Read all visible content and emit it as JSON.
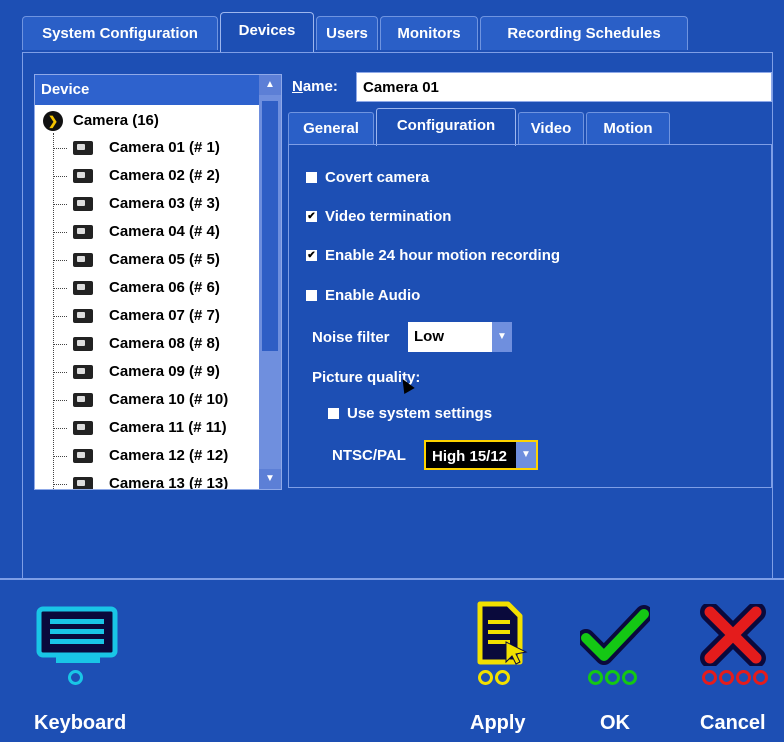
{
  "main_tabs": [
    {
      "label": "System Configuration"
    },
    {
      "label": "Devices"
    },
    {
      "label": "Users"
    },
    {
      "label": "Monitors"
    },
    {
      "label": "Recording Schedules"
    }
  ],
  "device_list": {
    "header": "Device",
    "root_label": "Camera (16)",
    "items": [
      {
        "label": "Camera 01 (# 1)"
      },
      {
        "label": "Camera 02 (# 2)"
      },
      {
        "label": "Camera 03 (# 3)"
      },
      {
        "label": "Camera 04 (# 4)"
      },
      {
        "label": "Camera 05 (# 5)"
      },
      {
        "label": "Camera 06 (# 6)"
      },
      {
        "label": "Camera 07 (# 7)"
      },
      {
        "label": "Camera 08 (# 8)"
      },
      {
        "label": "Camera 09 (# 9)"
      },
      {
        "label": "Camera 10 (# 10)"
      },
      {
        "label": "Camera 11 (# 11)"
      },
      {
        "label": "Camera 12 (# 12)"
      },
      {
        "label": "Camera 13 (# 13)"
      }
    ]
  },
  "name": {
    "label_underlined": "N",
    "label_rest": "ame:",
    "value": "Camera 01"
  },
  "sub_tabs": [
    {
      "label": "General"
    },
    {
      "label": "Configuration"
    },
    {
      "label": "Video"
    },
    {
      "label": "Motion"
    }
  ],
  "config": {
    "covert_camera": {
      "label": "Covert camera",
      "checked": false
    },
    "video_termination": {
      "label": "Video termination",
      "checked": true
    },
    "motion_recording": {
      "label": "Enable 24 hour motion recording",
      "checked": true
    },
    "enable_audio": {
      "label": "Enable Audio",
      "checked": false
    },
    "noise_filter": {
      "label": "Noise filter",
      "value": "Low"
    },
    "picture_quality_label": "Picture quality:",
    "use_system_settings": {
      "label": "Use system settings",
      "checked": false
    },
    "ntsc_pal": {
      "label": "NTSC/PAL",
      "value": "High 15/12"
    }
  },
  "bottom_actions": {
    "keyboard": "Keyboard",
    "apply": "Apply",
    "ok": "OK",
    "cancel": "Cancel"
  },
  "colors": {
    "background": "#1d4fb4",
    "keyboard_icon": "#19c6e6",
    "apply_icon": "#f2e000",
    "ok_icon": "#14c814",
    "cancel_icon": "#e41c1c",
    "highlight": "#ffd400"
  },
  "icons": [
    "keyboard-icon",
    "apply-document-icon",
    "ok-check-icon",
    "cancel-x-icon",
    "camera-icon",
    "camera-group-icon"
  ]
}
